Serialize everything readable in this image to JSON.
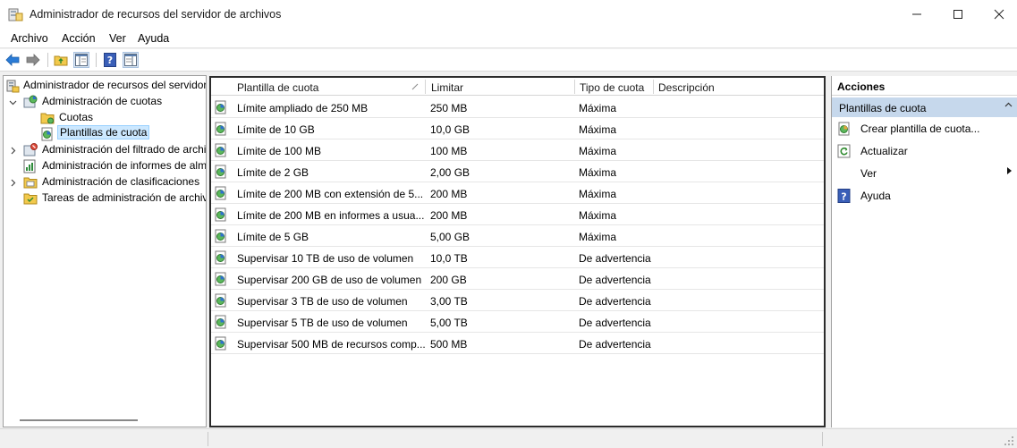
{
  "window": {
    "title": "Administrador de recursos del servidor de archivos",
    "controls": [
      "minimize-icon",
      "maximize-icon",
      "close-icon"
    ]
  },
  "menu": {
    "items": [
      {
        "label": "Archivo"
      },
      {
        "label": "Acción"
      },
      {
        "label": "Ver"
      },
      {
        "label": "Ayuda"
      }
    ]
  },
  "toolbar": {
    "icons": [
      "back-arrow-icon",
      "forward-arrow-icon",
      "up-folder-icon",
      "show-hide-tree-icon",
      "help-icon",
      "show-hide-action-pane-icon"
    ]
  },
  "tree": {
    "items": [
      {
        "label": "Administrador de recursos del servidor de archivos",
        "icon": "server-icon"
      },
      {
        "label": "Administración de cuotas",
        "icon": "quota-management-icon"
      },
      {
        "label": "Cuotas",
        "icon": "folder-icon"
      },
      {
        "label": "Plantillas de cuota",
        "icon": "quota-template-icon"
      },
      {
        "label": "Administración del filtrado de archivos",
        "icon": "file-screen-icon"
      },
      {
        "label": "Administración de informes de almacenamiento",
        "icon": "report-icon"
      },
      {
        "label": "Administración de clasificaciones",
        "icon": "classification-icon"
      },
      {
        "label": "Tareas de administración de archivos",
        "icon": "file-tasks-icon"
      }
    ]
  },
  "list": {
    "columns": [
      {
        "label": "Plantilla de cuota"
      },
      {
        "label": "Limitar"
      },
      {
        "label": "Tipo de cuota"
      },
      {
        "label": "Descripción"
      }
    ],
    "rows": [
      {
        "name": "Límite ampliado de 250 MB",
        "limit": "250 MB",
        "type": "Máxima",
        "description": ""
      },
      {
        "name": "Límite de 10 GB",
        "limit": "10,0 GB",
        "type": "Máxima",
        "description": ""
      },
      {
        "name": "Límite de 100 MB",
        "limit": "100 MB",
        "type": "Máxima",
        "description": ""
      },
      {
        "name": "Límite de 2 GB",
        "limit": "2,00 GB",
        "type": "Máxima",
        "description": ""
      },
      {
        "name": "Límite de 200 MB con extensión de 5...",
        "limit": "200 MB",
        "type": "Máxima",
        "description": ""
      },
      {
        "name": "Límite de 200 MB en informes a usua...",
        "limit": "200 MB",
        "type": "Máxima",
        "description": ""
      },
      {
        "name": "Límite de 5 GB",
        "limit": "5,00 GB",
        "type": "Máxima",
        "description": ""
      },
      {
        "name": "Supervisar 10 TB de uso de volumen",
        "limit": "10,0 TB",
        "type": "De advertencia",
        "description": ""
      },
      {
        "name": "Supervisar 200 GB de uso de volumen",
        "limit": "200 GB",
        "type": "De advertencia",
        "description": ""
      },
      {
        "name": "Supervisar 3 TB de uso de volumen",
        "limit": "3,00 TB",
        "type": "De advertencia",
        "description": ""
      },
      {
        "name": "Supervisar 5 TB de uso de volumen",
        "limit": "5,00 TB",
        "type": "De advertencia",
        "description": ""
      },
      {
        "name": "Supervisar 500 MB de recursos comp...",
        "limit": "500 MB",
        "type": "De advertencia",
        "description": ""
      }
    ]
  },
  "actions": {
    "header": "Acciones",
    "section": "Plantillas de cuota",
    "items": [
      {
        "label": "Crear plantilla de cuota...",
        "icon": "create-template-icon"
      },
      {
        "label": "Actualizar",
        "icon": "refresh-icon"
      },
      {
        "label": "Ver",
        "icon": ""
      },
      {
        "label": "Ayuda",
        "icon": "help-icon"
      }
    ]
  },
  "colors": {
    "selection": "#cce8ff",
    "section_bg": "#c6d8ec",
    "accent_blue": "#1e6fd1"
  }
}
